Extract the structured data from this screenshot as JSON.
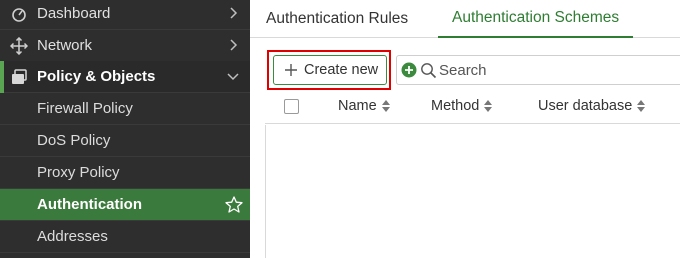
{
  "sidebar": {
    "items": [
      {
        "label": "Dashboard",
        "icon": "dashboard-icon"
      },
      {
        "label": "Network",
        "icon": "network-move-icon"
      },
      {
        "label": "Policy & Objects",
        "icon": "policy-objects-icon"
      },
      {
        "label": "Firewall Policy"
      },
      {
        "label": "DoS Policy"
      },
      {
        "label": "Proxy Policy"
      },
      {
        "label": "Authentication"
      },
      {
        "label": "Addresses"
      }
    ]
  },
  "tabs": [
    {
      "label": "Authentication Rules"
    },
    {
      "label": "Authentication Schemes"
    }
  ],
  "toolbar": {
    "create_label": "Create new",
    "search_placeholder": "Search"
  },
  "table": {
    "columns": [
      "Name",
      "Method",
      "User database"
    ]
  },
  "colors": {
    "sidebar_bg": "#2e2e2e",
    "active_green": "#3b7a3d",
    "accent_green": "#2e7d32",
    "highlight_red": "#e00000"
  }
}
